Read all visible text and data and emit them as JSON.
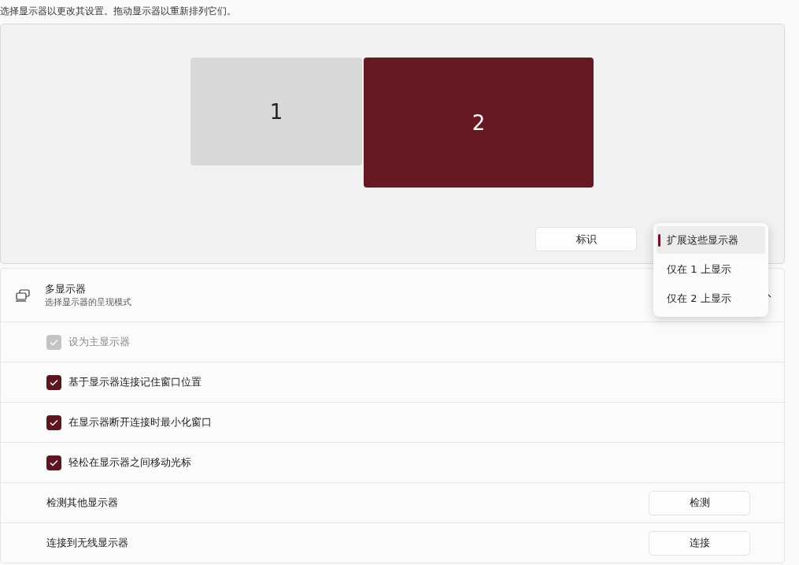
{
  "instructions": "选择显示器以更改其设置。拖动显示器以重新排列它们。",
  "monitors": [
    {
      "label": "1",
      "selected": false
    },
    {
      "label": "2",
      "selected": true
    }
  ],
  "identify_button": "标识",
  "display_mode_menu": [
    {
      "label": "扩展这些显示器",
      "selected": true
    },
    {
      "label": "仅在 1 上显示",
      "selected": false
    },
    {
      "label": "仅在 2 上显示",
      "selected": false
    }
  ],
  "multiple_displays": {
    "title": "多显示器",
    "subtitle": "选择显示器的呈现模式",
    "expanded": true
  },
  "rows": [
    {
      "kind": "checkbox",
      "label": "设为主显示器",
      "checked": true,
      "disabled": true
    },
    {
      "kind": "checkbox",
      "label": "基于显示器连接记住窗口位置",
      "checked": true,
      "disabled": false
    },
    {
      "kind": "checkbox",
      "label": "在显示器断开连接时最小化窗口",
      "checked": true,
      "disabled": false
    },
    {
      "kind": "checkbox",
      "label": "轻松在显示器之间移动光标",
      "checked": true,
      "disabled": false
    },
    {
      "kind": "button",
      "label": "检测其他显示器",
      "button": "检测"
    },
    {
      "kind": "button",
      "label": "连接到无线显示器",
      "button": "连接"
    }
  ]
}
